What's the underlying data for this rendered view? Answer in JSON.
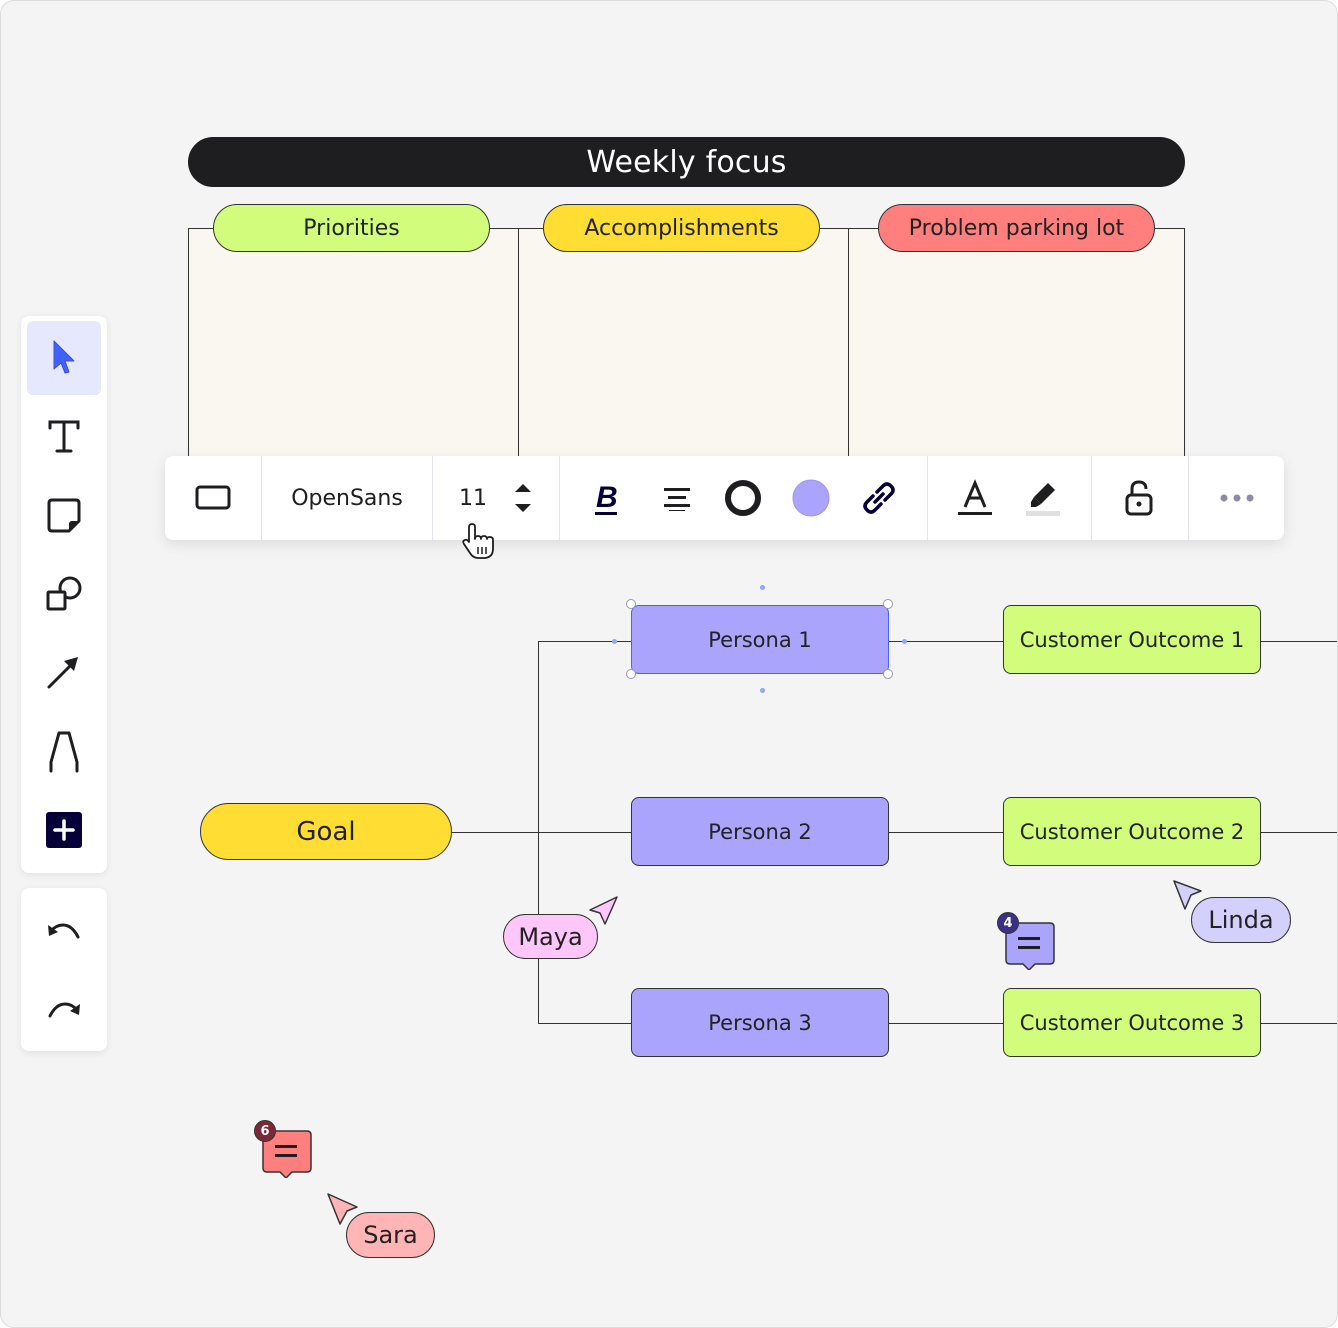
{
  "board": {
    "frame_title": "Weekly focus",
    "columns": [
      {
        "label": "Priorities",
        "color": "#d1fc7c"
      },
      {
        "label": "Accomplishments",
        "color": "#ffdd33"
      },
      {
        "label": "Problem parking lot",
        "color": "#ff7f7f"
      }
    ]
  },
  "left_toolbar": {
    "tools": [
      {
        "name": "select",
        "icon": "cursor-icon",
        "active": true
      },
      {
        "name": "text",
        "icon": "text-icon"
      },
      {
        "name": "sticky-note",
        "icon": "sticky-note-icon"
      },
      {
        "name": "shapes",
        "icon": "shapes-icon"
      },
      {
        "name": "connector",
        "icon": "arrow-icon"
      },
      {
        "name": "pen",
        "icon": "pen-icon"
      },
      {
        "name": "more-tools",
        "icon": "plus-icon"
      }
    ],
    "history": [
      {
        "name": "undo",
        "icon": "undo-icon"
      },
      {
        "name": "redo",
        "icon": "redo-icon"
      }
    ]
  },
  "context_toolbar": {
    "shape_icon": "rectangle-icon",
    "font_family": "OpenSans",
    "font_size": "11",
    "fill_color": "#aaa4fd",
    "items": [
      "bold",
      "align-center",
      "border-style",
      "fill-color",
      "link",
      "text-color",
      "highlight",
      "lock",
      "more"
    ]
  },
  "diagram": {
    "goal": "Goal",
    "personas": [
      "Persona 1",
      "Persona 2",
      "Persona 3"
    ],
    "outcomes": [
      "Customer Outcome 1",
      "Customer Outcome 2",
      "Customer Outcome 3"
    ],
    "selected": "Persona 1"
  },
  "collaborators": [
    {
      "name": "Maya",
      "color": "#ffc6fa"
    },
    {
      "name": "Linda",
      "color": "#d4d0fd"
    },
    {
      "name": "Sara",
      "color": "#ffb5b5"
    }
  ],
  "comments": [
    {
      "count": "4",
      "color": "#aaa4fd",
      "badge_color": "#3b2f86"
    },
    {
      "count": "6",
      "color": "#ff7f7f",
      "badge_color": "#7a2a36"
    }
  ]
}
